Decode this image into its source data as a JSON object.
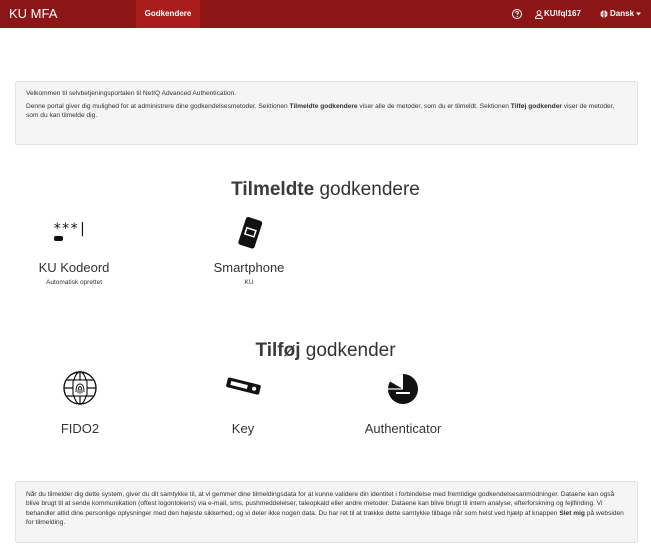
{
  "navbar": {
    "brand": "KU MFA",
    "tab": "Godkendere",
    "user": "KU\\fql167",
    "language": "Dansk"
  },
  "intro": {
    "line1": "Velkommen til selvbetjeningsportalen til NetIQ Advanced Authentication.",
    "line2_part1": "Denne portal giver dig mulighed for at administrere dine godkendelsesmetoder. Sektionen ",
    "line2_bold1": "Tilmeldte godkendere",
    "line2_part2": " viser alle de metoder, som du er tilmeldt. Sektionen ",
    "line2_bold2": "Tilføj godkender",
    "line2_part3": " viser de metoder, som du kan tilmelde dig."
  },
  "enrolled": {
    "title_bold": "Tilmeldte",
    "title_rest": " godkendere",
    "items": [
      {
        "name": "KU Kodeord",
        "sub": "Automatisk oprettet",
        "icon": "password-icon",
        "icon_text": "***|"
      },
      {
        "name": "Smartphone",
        "sub": "KU",
        "icon": "smartphone-icon"
      }
    ]
  },
  "add": {
    "title_bold": "Tilføj",
    "title_rest": " godkender",
    "items": [
      {
        "name": "FIDO2",
        "icon": "globe-fingerprint-icon"
      },
      {
        "name": "Key",
        "icon": "usb-key-icon"
      },
      {
        "name": "Authenticator",
        "icon": "authenticator-icon"
      }
    ]
  },
  "consent": {
    "text": "Når du tilmelder dig dette system, giver du dit samtykke til, at vi gemmer dine tilmeldingsdata for at kunne validere din identitet i forbindelse med fremtidige godkendelsesanmodninger. Dataene kan også blive brugt til at sende kommunikation (oftest logontokens) via e-mail, sms, pushmeddelelser, taleopkald eller andre metoder. Dataene kan blive brugt til intern analyse, efterforskning og fejlfinding. Vi behandler altid dine personlige oplysninger med den højeste sikkerhed, og vi deler ikke nogen data. Du har ret til at trække dette samtykke tilbage når som helst ved hjælp af knappen ",
    "bold": "Slet mig",
    "tail": " på websiden for tilmelding."
  },
  "colors": {
    "navbar": "#8c1515",
    "active_tab": "#a91d1d",
    "panel": "#f5f5f5"
  }
}
